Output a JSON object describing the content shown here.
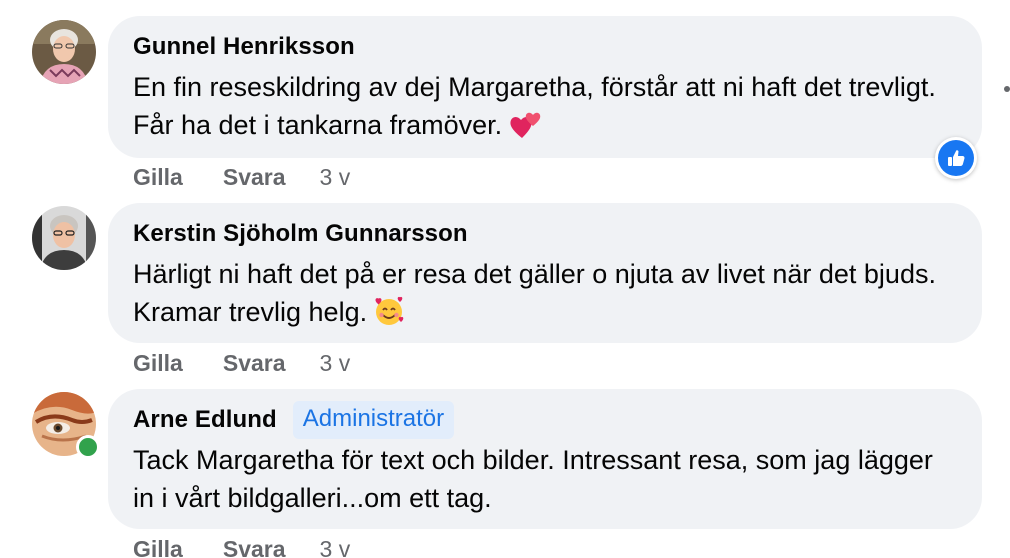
{
  "comments": [
    {
      "author": "Gunnel Henriksson",
      "text": "En fin reseskildring av dej Margaretha, förstår att ni haft det trevligt. Får ha det i tankarna framöver.",
      "emoji": "two-hearts",
      "actions": {
        "like": "Gilla",
        "reply": "Svara"
      },
      "time": "3 v",
      "reaction": "like-reaction-icon"
    },
    {
      "author": "Kerstin Sjöholm Gunnarsson",
      "text": "Härligt ni haft det på er resa det gäller o njuta av livet när det bjuds. Kramar trevlig helg.",
      "emoji": "smiling-face-with-hearts",
      "actions": {
        "like": "Gilla",
        "reply": "Svara"
      },
      "time": "3 v"
    },
    {
      "author": "Arne Edlund",
      "badge": "Administratör",
      "text": "Tack Margaretha för text och bilder. Intressant resa, som jag lägger in i vårt bildgalleri...om ett tag.",
      "actions": {
        "like": "Gilla",
        "reply": "Svara"
      },
      "time": "3 v",
      "online": true
    }
  ],
  "colors": {
    "bubble": "#f0f2f5",
    "name": "#050505",
    "meta": "#65676b",
    "badge_bg": "#e2edfb",
    "badge_text": "#1b74e4",
    "like_blue": "#1877f2",
    "online_green": "#31a24c"
  }
}
